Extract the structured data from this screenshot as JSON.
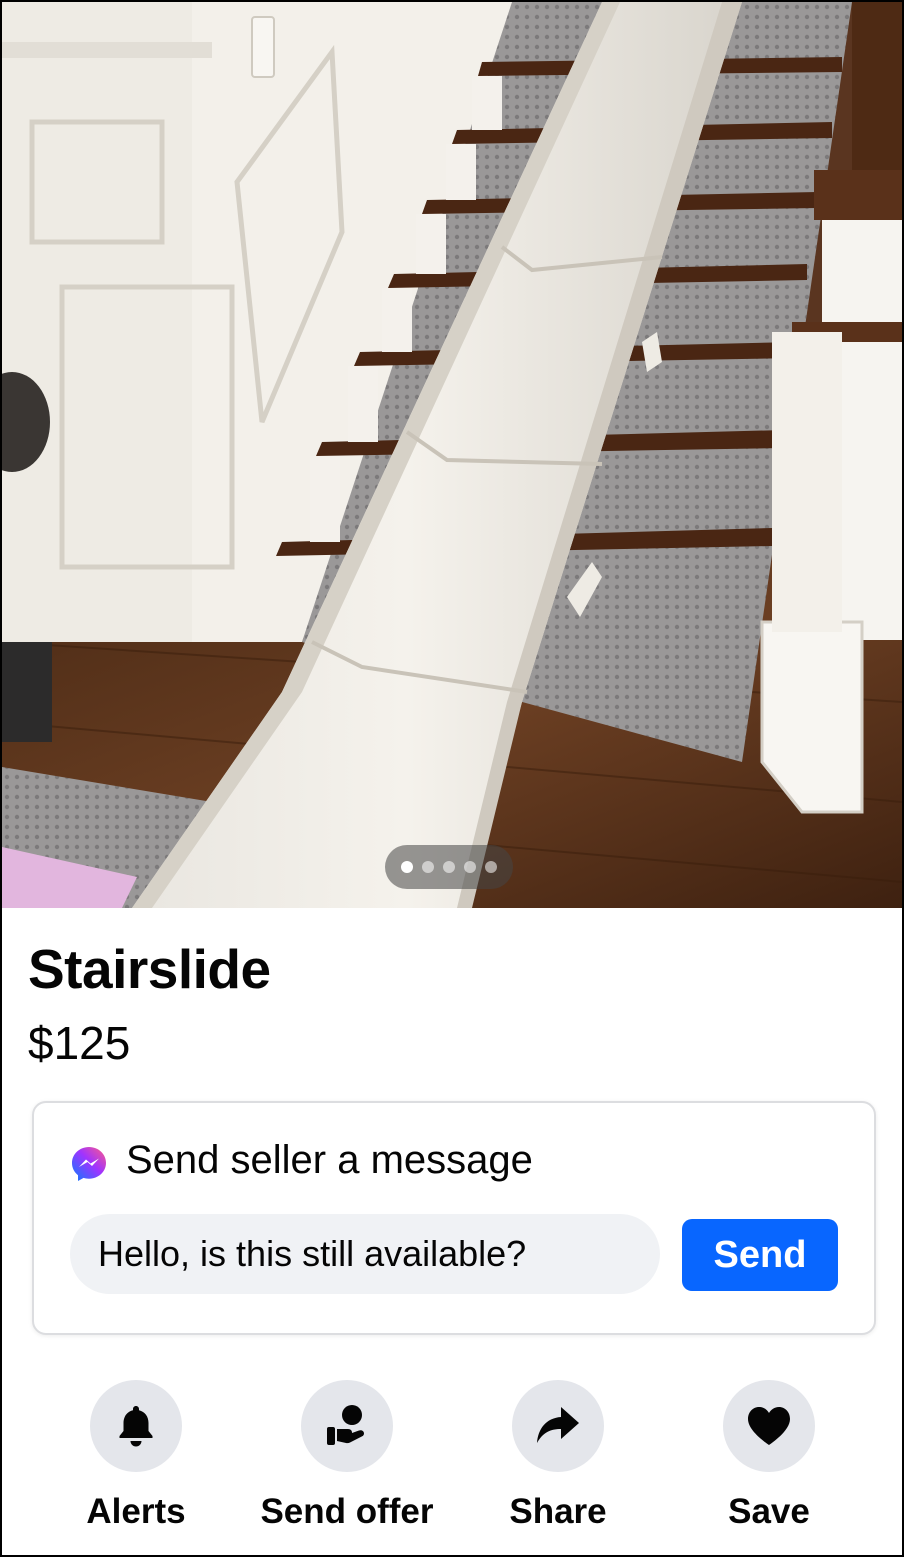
{
  "listing": {
    "title": "Stairslide",
    "price": "$125",
    "photo": {
      "subject": "white plastic slide on carpeted stairs",
      "dot_count": 5,
      "active_dot": 1
    }
  },
  "message": {
    "header": "Send seller a message",
    "header_icon": "messenger-icon",
    "input_value": "Hello, is this still available?",
    "send_label": "Send"
  },
  "actions": [
    {
      "label": "Alerts",
      "icon": "bell-icon"
    },
    {
      "label": "Send offer",
      "icon": "offer-icon"
    },
    {
      "label": "Share",
      "icon": "share-arrow-icon"
    },
    {
      "label": "Save",
      "icon": "heart-icon"
    }
  ],
  "colors": {
    "accent": "#0866ff",
    "icon_circle": "#e4e6eb",
    "input_bg": "#f0f2f5",
    "text": "#050505"
  }
}
